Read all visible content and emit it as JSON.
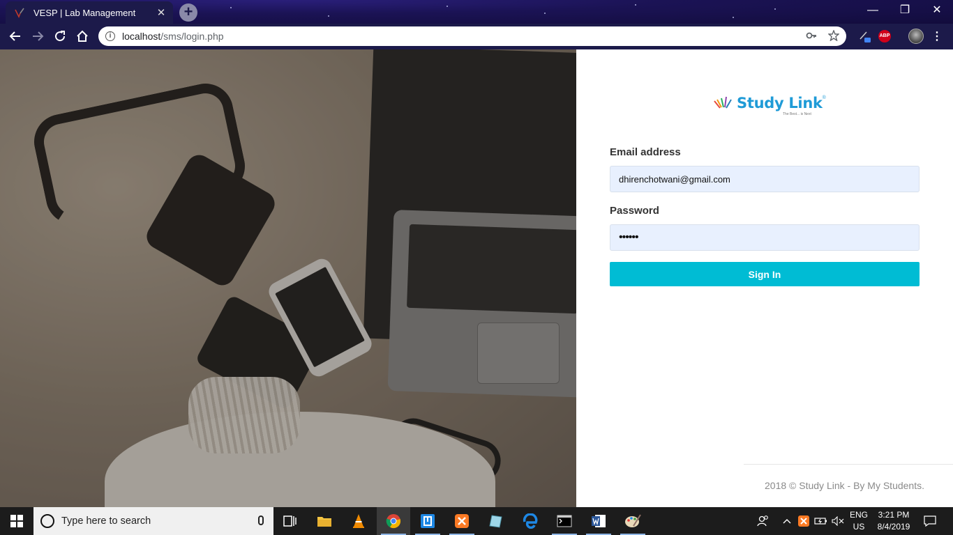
{
  "browser": {
    "tab_title": "VESP | Lab Management",
    "tab_close": "✕",
    "new_tab": "+",
    "url_host": "localhost",
    "url_path": "/sms/login.php",
    "window_controls": {
      "minimize": "—",
      "restore": "❐",
      "close": "✕"
    },
    "extensions": {
      "abp": "ABP"
    }
  },
  "login": {
    "logo_text": "Study Link",
    "logo_reg": "®",
    "logo_tagline": "The Best... is Next",
    "email_label": "Email address",
    "email_value": "dhirenchotwani@gmail.com",
    "password_label": "Password",
    "password_value": "••••••",
    "signin_label": "Sign In",
    "footer": "2018 © Study Link - By My Students."
  },
  "taskbar": {
    "search_placeholder": "Type here to search",
    "lang_line1": "ENG",
    "lang_line2": "US",
    "time": "3:21 PM",
    "date": "8/4/2019"
  },
  "colors": {
    "chrome_bg": "#1c1a4a",
    "accent_button": "#00bcd4",
    "logo_blue": "#1f9bd7",
    "input_bg": "#e8f0fe"
  }
}
